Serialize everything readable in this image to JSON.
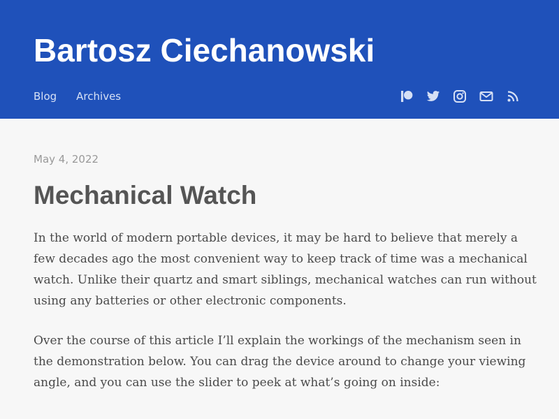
{
  "header": {
    "site_title": "Bartosz Ciechanowski",
    "nav": [
      {
        "label": "Blog"
      },
      {
        "label": "Archives"
      }
    ],
    "social_icons": [
      "patreon-icon",
      "twitter-icon",
      "instagram-icon",
      "email-icon",
      "rss-icon"
    ],
    "background_color": "#1f51ba",
    "icon_color": "#d6e0f5"
  },
  "post": {
    "date": "May 4, 2022",
    "title": "Mechanical Watch",
    "paragraphs": [
      {
        "lines": [
          "In the world of modern portable devices, it may be hard to believe that merely a",
          "few decades ago the most convenient way to keep track of time was a mechanical",
          "watch. Unlike their quartz and smart siblings, mechanical watches can run without",
          "using any batteries or other electronic components."
        ]
      },
      {
        "lines": [
          "Over the course of this article I’ll explain the workings of the mechanism seen in",
          "the demonstration below. You can drag the device around to change your viewing",
          "angle, and you can use the slider to peek at what’s going on inside:"
        ]
      }
    ]
  },
  "page_background": "#f7f7f7"
}
